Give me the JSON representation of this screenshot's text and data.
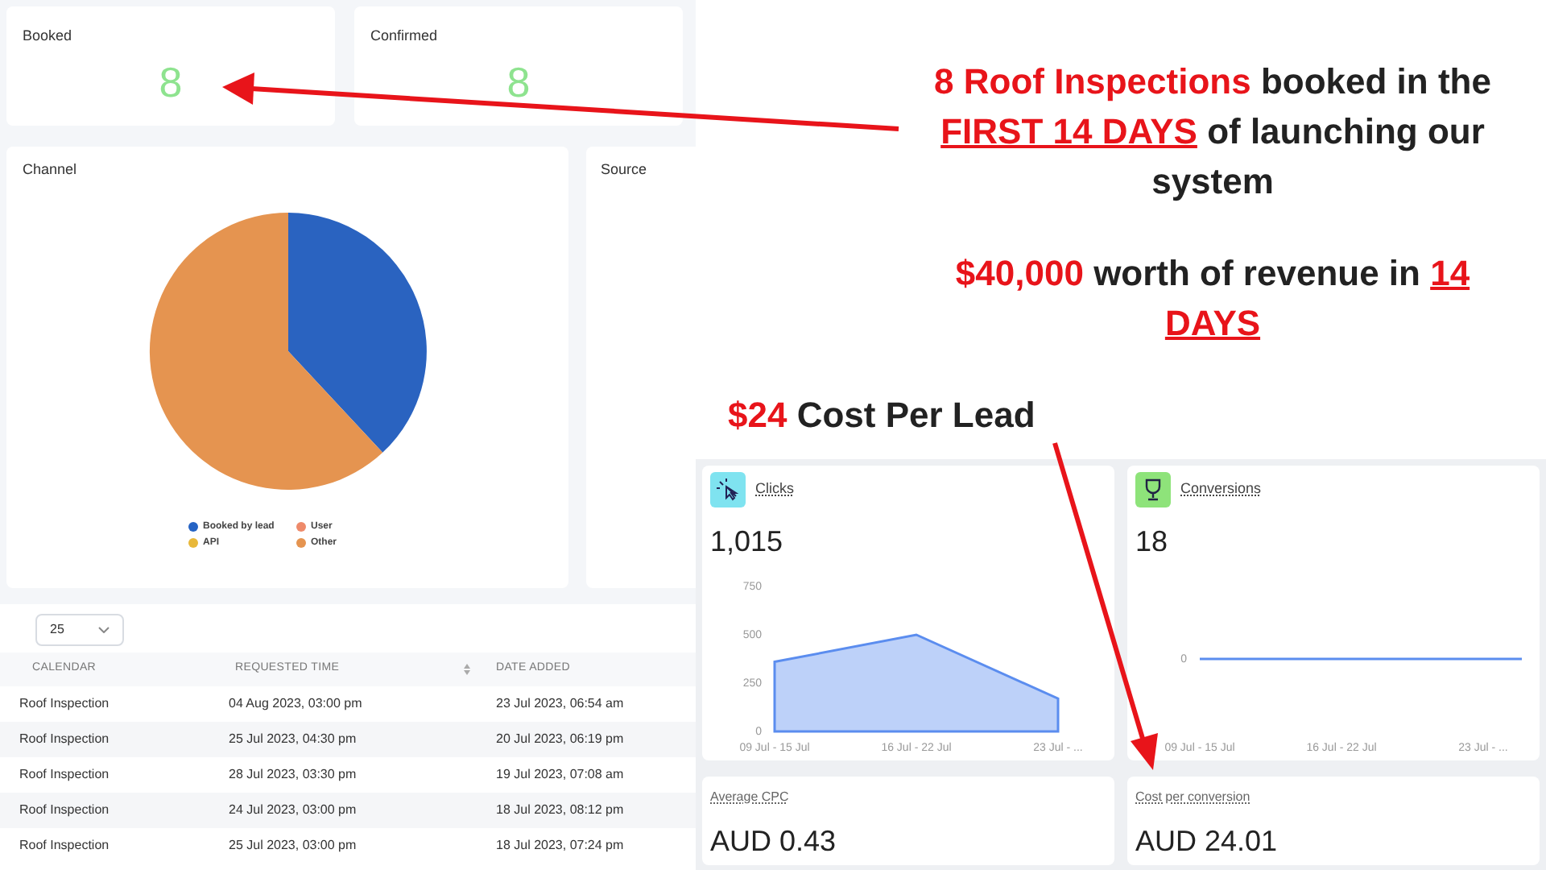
{
  "stat_cards": [
    {
      "label": "Booked",
      "value": "8"
    },
    {
      "label": "Confirmed",
      "value": "8"
    }
  ],
  "channel_panel": {
    "title": "Channel",
    "legend": [
      {
        "label": "Booked by lead",
        "color": "#2563c4"
      },
      {
        "label": "User",
        "color": "#ee8a6a"
      },
      {
        "label": "API",
        "color": "#e8b83a"
      },
      {
        "label": "Other",
        "color": "#e59450"
      }
    ]
  },
  "source_panel": {
    "title": "Source"
  },
  "page_size_select": {
    "value": "25"
  },
  "table": {
    "columns": [
      "CALENDAR",
      "REQUESTED TIME",
      "DATE ADDED"
    ],
    "rows": [
      [
        "Roof Inspection",
        "04 Aug 2023, 03:00 pm",
        "23 Jul 2023, 06:54 am"
      ],
      [
        "Roof Inspection",
        "25 Jul 2023, 04:30 pm",
        "20 Jul 2023, 06:19 pm"
      ],
      [
        "Roof Inspection",
        "28 Jul 2023, 03:30 pm",
        "19 Jul 2023, 07:08 am"
      ],
      [
        "Roof Inspection",
        "24 Jul 2023, 03:00 pm",
        "18 Jul 2023, 08:12 pm"
      ],
      [
        "Roof Inspection",
        "25 Jul 2023, 03:00 pm",
        "18 Jul 2023, 07:24 pm"
      ]
    ]
  },
  "callouts": [
    [
      {
        "text": "8 Roof Inspections",
        "kind": "highlight"
      },
      {
        "text": " booked in the ",
        "kind": "plain"
      },
      {
        "text": "FIRST 14 DAYS",
        "kind": "underlined"
      },
      {
        "text": " of launching our system",
        "kind": "plain"
      }
    ],
    [
      {
        "text": "$40,000",
        "kind": "highlight"
      },
      {
        "text": " worth of revenue in ",
        "kind": "plain"
      },
      {
        "text": "14 DAYS",
        "kind": "underlined"
      }
    ],
    [
      {
        "text": "$24",
        "kind": "highlight"
      },
      {
        "text": " Cost Per Lead",
        "kind": "plain"
      }
    ]
  ],
  "ad_metrics": [
    {
      "title": "Clicks",
      "value": "1,015",
      "chart_data": {
        "type": "area",
        "categories": [
          "09 Jul - 15 Jul",
          "16 Jul - 22 Jul",
          "23 Jul - ..."
        ],
        "series": [
          {
            "color": "#5b8def",
            "values": [
              360,
              500,
              170
            ]
          }
        ],
        "ylim": [
          0,
          750
        ],
        "yticks": [
          0,
          250,
          500,
          750
        ]
      }
    },
    {
      "title": "Conversions",
      "value": "18",
      "trend_picture": {
        "x_labels": [
          "09 Jul - 15 Jul",
          "16 Jul - 22 Jul",
          "23 Jul - ..."
        ],
        "y_label": "0"
      }
    }
  ],
  "summary_metrics": [
    {
      "label": "Average CPC",
      "value": "AUD 0.43"
    },
    {
      "label": "Cost per conversion",
      "value": "AUD 24.01"
    }
  ]
}
